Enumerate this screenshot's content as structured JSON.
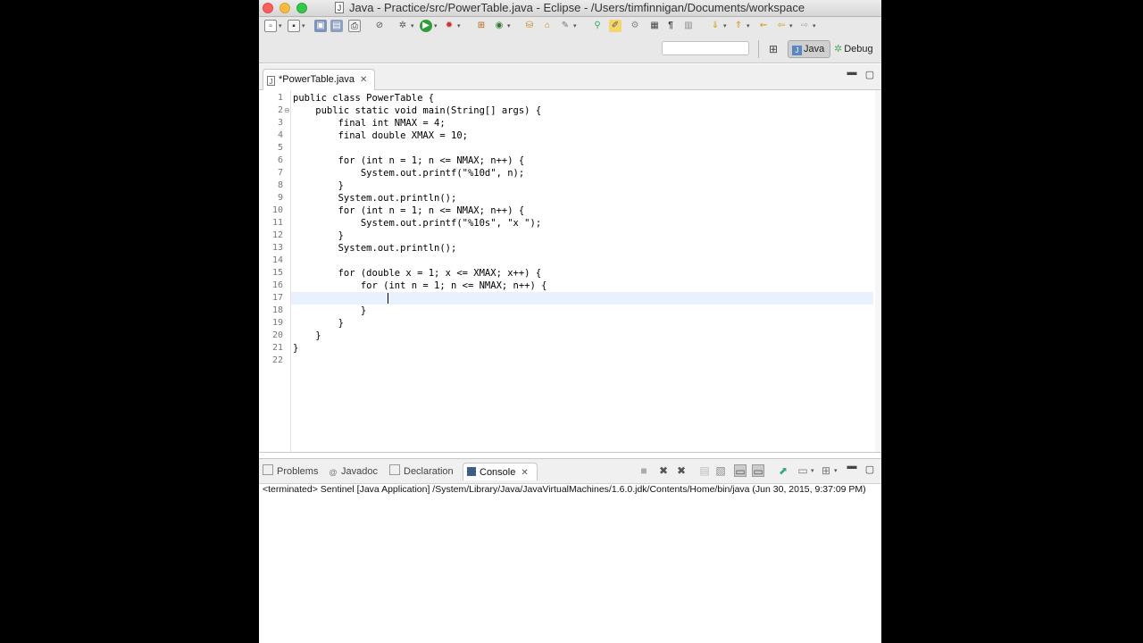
{
  "window": {
    "title": "Java - Practice/src/PowerTable.java - Eclipse - /Users/timfinnigan/Documents/workspace"
  },
  "perspectives": {
    "java_label": "Java",
    "debug_label": "Debug"
  },
  "editor": {
    "tab_label": "*PowerTable.java",
    "cursor_line": 17,
    "lines": [
      {
        "num": "1",
        "text": "public class PowerTable {"
      },
      {
        "num": "2",
        "text": "    public static void main(String[] args) {"
      },
      {
        "num": "3",
        "text": "        final int NMAX = 4;"
      },
      {
        "num": "4",
        "text": "        final double XMAX = 10;"
      },
      {
        "num": "5",
        "text": ""
      },
      {
        "num": "6",
        "text": "        for (int n = 1; n <= NMAX; n++) {"
      },
      {
        "num": "7",
        "text": "            System.out.printf(\"%10d\", n);"
      },
      {
        "num": "8",
        "text": "        }"
      },
      {
        "num": "9",
        "text": "        System.out.println();"
      },
      {
        "num": "10",
        "text": "        for (int n = 1; n <= NMAX; n++) {"
      },
      {
        "num": "11",
        "text": "            System.out.printf(\"%10s\", \"x \");"
      },
      {
        "num": "12",
        "text": "        }"
      },
      {
        "num": "13",
        "text": "        System.out.println();"
      },
      {
        "num": "14",
        "text": ""
      },
      {
        "num": "15",
        "text": "        for (double x = 1; x <= XMAX; x++) {"
      },
      {
        "num": "16",
        "text": "            for (int n = 1; n <= NMAX; n++) {"
      },
      {
        "num": "17",
        "text": ""
      },
      {
        "num": "18",
        "text": "            }"
      },
      {
        "num": "19",
        "text": "        }"
      },
      {
        "num": "20",
        "text": "    }"
      },
      {
        "num": "21",
        "text": "}"
      },
      {
        "num": "22",
        "text": ""
      }
    ]
  },
  "console_tabs": {
    "problems": "Problems",
    "javadoc": "Javadoc",
    "declaration": "Declaration",
    "console": "Console"
  },
  "console": {
    "status": "<terminated> Sentinel [Java Application] /System/Library/Java/JavaVirtualMachines/1.6.0.jdk/Contents/Home/bin/java (Jun 30, 2015, 9:37:09 PM)"
  },
  "icons": {
    "window_close": "close-traffic-light",
    "file": "java-file-icon",
    "run": "run-icon",
    "debug": "debug-icon"
  }
}
